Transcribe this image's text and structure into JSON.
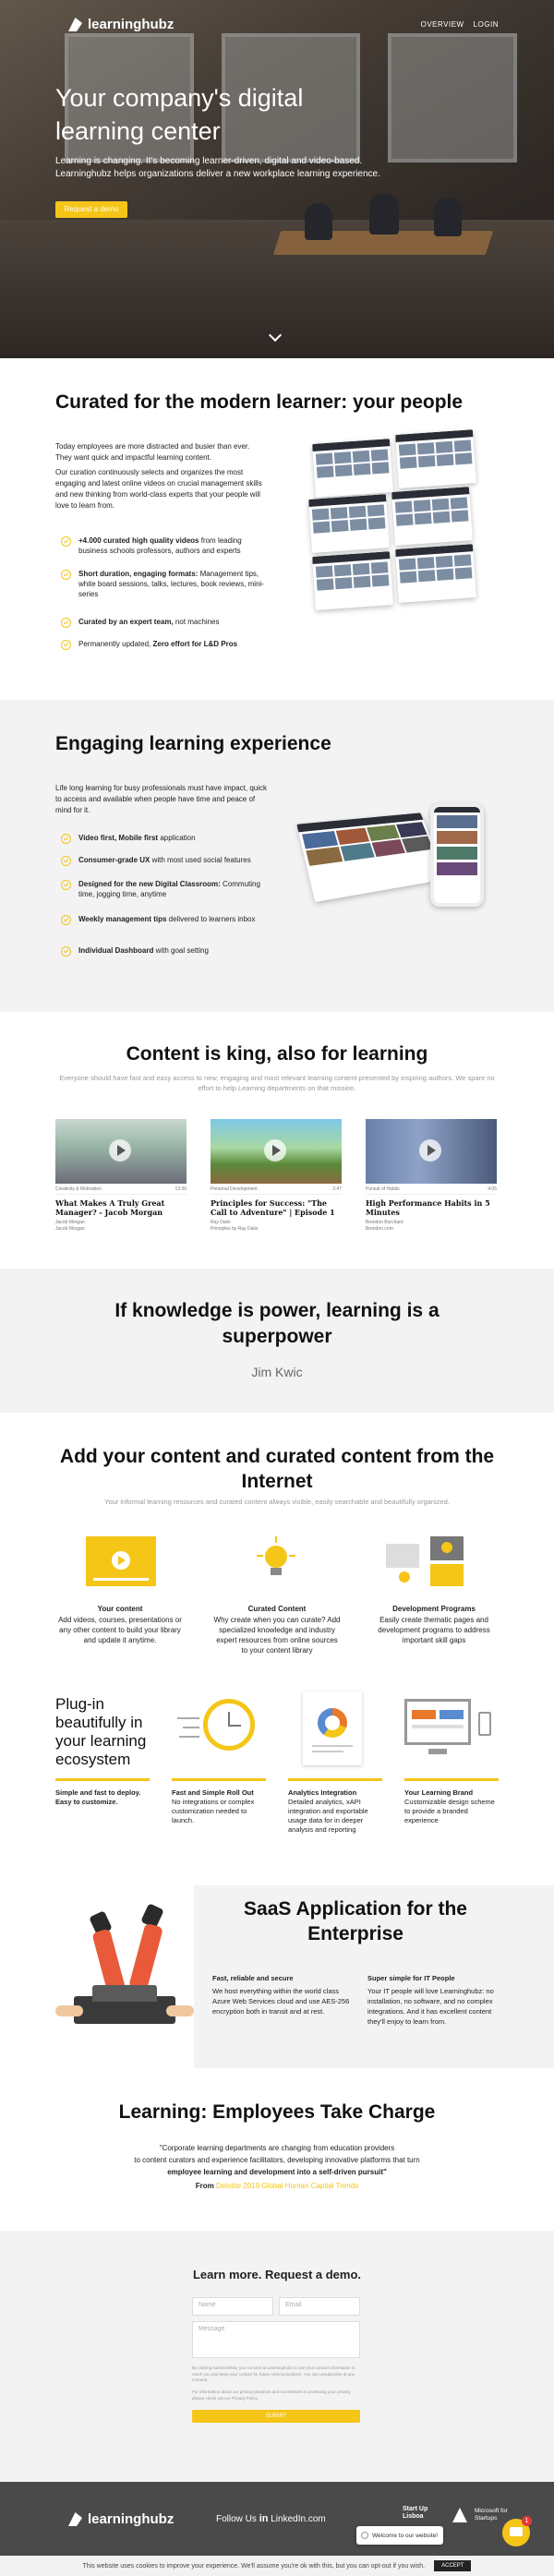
{
  "nav": {
    "brand": "learninghubz",
    "links": [
      "OVERVIEW",
      "LOGIN"
    ]
  },
  "hero": {
    "title": "Your company's digital learning center",
    "subtitle": "Learning is changing. It's becoming learner-driven, digital and video-based. Learninghubz helps organizations deliver a new workplace learning experience.",
    "cta": "Request a demo"
  },
  "curated": {
    "title": "Curated for the modern learner: your people",
    "p1": "Today employees are more distracted and busier than ever. They want quick and impactful learning content.",
    "p2": "Our curation continuously selects and organizes the most engaging and latest online videos on crucial management skills and new thinking from world-class experts that your people will love to learn from.",
    "items": [
      {
        "bold": "+4.000 curated high quality videos",
        "rest": " from leading business schools professors, authors and experts"
      },
      {
        "bold": "Short duration, engaging formats:",
        "rest": " Management tips, white board sessions, talks, lectures, book reviews, mini-series"
      },
      {
        "bold": "Curated by an expert team,",
        "rest": " not machines"
      },
      {
        "pre": "Permanently updated, ",
        "bold": "Zero effort for L&D Pros",
        "rest": ""
      }
    ]
  },
  "engaging": {
    "title": "Engaging learning experience",
    "p1": "Life long learning for busy professionals must have impact, quick to access and available when people have time and peace of mind for it.",
    "items": [
      {
        "bold": "Video first, Mobile first",
        "rest": " application"
      },
      {
        "bold": "Consumer-grade UX",
        "rest": " with most used social features"
      },
      {
        "bold": "Designed for the new Digital Classroom:",
        "rest": " Commuting time, jogging time, anytime"
      },
      {
        "bold": "Weekly management tips",
        "rest": " delivered to learners inbox"
      },
      {
        "bold": "Individual Dashboard",
        "rest": " with goal setting"
      }
    ]
  },
  "content": {
    "title": "Content is king, also for learning",
    "subtitle": "Everyone should have fast and easy access to new, engaging and most relevant learning content presented by inspiring authors. We spare no effort to help Learning departments on that mission.",
    "videos": [
      {
        "cat": "Creativity & Motivation",
        "dur": "13:30",
        "title": "What Makes A Truly Great Manager? - Jacob Morgan",
        "a1": "Jacob Morgan",
        "a2": "Jacob Morgan"
      },
      {
        "cat": "Personal Development",
        "dur": "2:47",
        "title": "Principles for Success: \"The Call to Adventure\" | Episode 1",
        "a1": "Ray Dalio",
        "a2": "Principles by Ray Dalio"
      },
      {
        "cat": "Pursuit of Habits",
        "dur": "4:05",
        "title": "High Performance Habits in 5 Minutes",
        "a1": "Brendon Burchard",
        "a2": "Brendon.com"
      }
    ]
  },
  "quote": {
    "text": "If knowledge is power, learning is a superpower",
    "author": "Jim Kwic"
  },
  "addcontent": {
    "title": "Add your content and curated content from the Internet",
    "subtitle": "Your informal learning resources and curated content always visible, easily searchable and beautifully organized.",
    "features": [
      {
        "title": "Your content",
        "text": "Add videos, courses, presentations or any other content to build your library and update it anytime."
      },
      {
        "title": "Curated Content",
        "text": "Why create when you can curate? Add specialized knowledge and industry expert resources from online sources to your content library"
      },
      {
        "title": "Development Programs",
        "text": "Easily create thematic pages and development programs to address important skill gaps"
      }
    ]
  },
  "plugins": {
    "heading": "Plug-in beautifully in your learning ecosystem",
    "features": [
      {
        "title": "Simple and fast to deploy. Easy to customize.",
        "text": ""
      },
      {
        "title": "Fast and Simple Roll Out",
        "text": "No integrations or complex customization needed to launch."
      },
      {
        "title": "Analytics Integration",
        "text": "Detailed analytics, xAPI integration and exportable usage data for in deeper analysis and reporting"
      },
      {
        "title": "Your Learning Brand",
        "text": "Customizable design scheme to provide a branded experience"
      }
    ]
  },
  "saas": {
    "title": "SaaS Application for the Enterprise",
    "cols": [
      {
        "title": "Fast, reliable and secure",
        "text": "We host everything within the world class Azure Web Services cloud and use AES-256 encryption both in transit and at rest."
      },
      {
        "title": "Super simple for IT People",
        "text": "Your IT people will love Learninghubz: no installation, no software, and no complex integrations. And it has excellent content they'll enjoy to learn from."
      }
    ]
  },
  "employees": {
    "title": "Learning: Employees Take Charge",
    "quote1": "\"Corporate learning departments are changing from education providers",
    "quote2": "to content curators and experience facilitators, developing innovative platforms that turn",
    "quote3": "employee learning and development into a self-driven pursuit\"",
    "from": "From",
    "source": "Deloitte 2019 Global Human Capital Trends"
  },
  "demo": {
    "title": "Learn more. Request a demo.",
    "name_ph": "Name",
    "email_ph": "Email",
    "message_ph": "Message",
    "fine1": "By clicking submit below, you consent to Learninghubz to use your contact information to reach you and keep your contact for future communications. You can unsubscribe at any moment.",
    "fine2": "For information about our privacy practices and commitment to protecting your privacy, please check out our Privacy Policy.",
    "submit": "SUBMIT"
  },
  "footer": {
    "brand": "learninghubz",
    "follow": "Follow Us",
    "linkedin": "LinkedIn.com",
    "startup": "Start Up Lisboa",
    "ms": "Microsoft for Startups"
  },
  "chat": {
    "text": "Welcome to our website!",
    "badge": "1"
  },
  "cookie": {
    "text": "This website uses cookies to improve your experience. We'll assume you're ok with this, but you can opt-out if you wish.",
    "accept": "ACCEPT"
  },
  "colors": {
    "accent": "#f5c518",
    "gray_bg": "#f3f3f3",
    "footer": "#4a4a4a"
  }
}
